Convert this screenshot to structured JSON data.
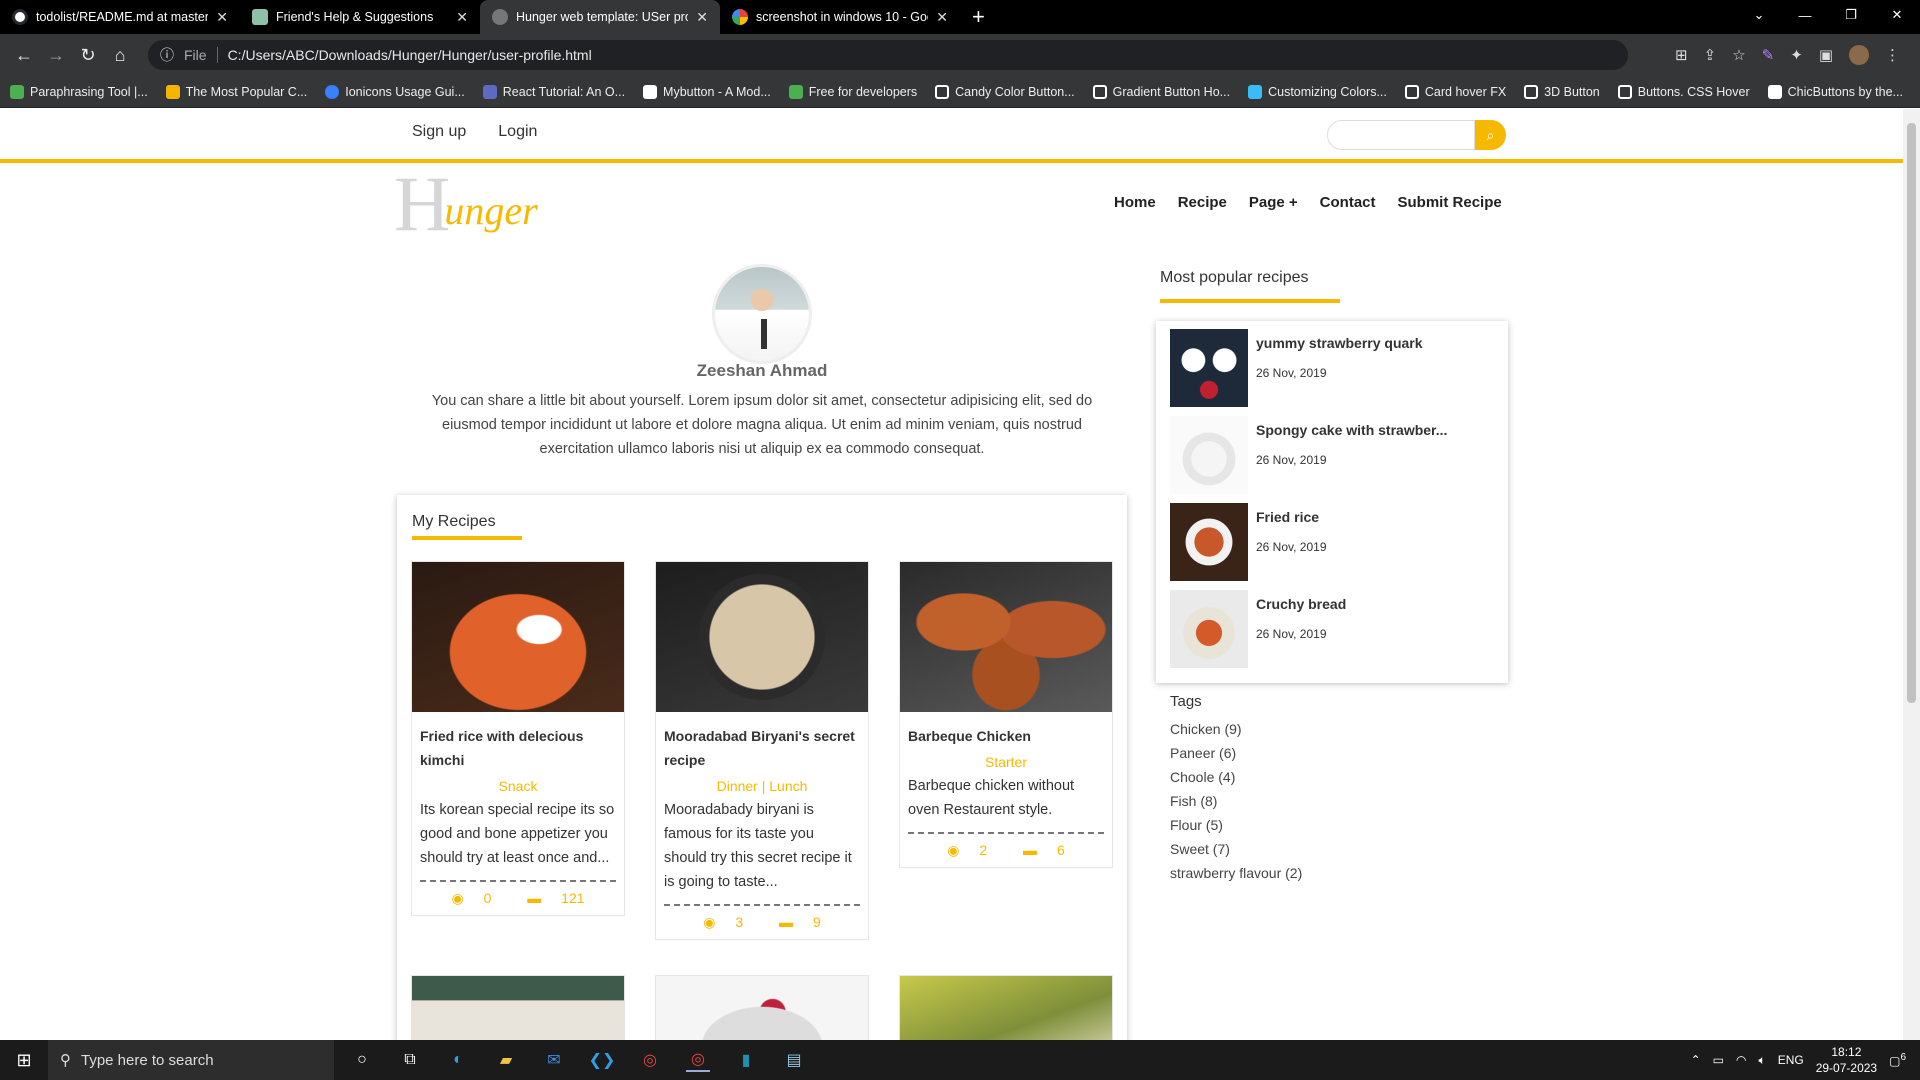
{
  "browser": {
    "tabs": [
      {
        "title": "todolist/README.md at master ·",
        "active": false,
        "color": "#24292f"
      },
      {
        "title": "Friend's Help & Suggestions",
        "active": false,
        "color": "#8fc1a9"
      },
      {
        "title": "Hunger web template: USer profi",
        "active": true,
        "color": "#777777"
      },
      {
        "title": "screenshot in windows 10 - Goog",
        "active": false,
        "color": "#4285f4"
      }
    ],
    "new_tab": "+",
    "address": {
      "scheme_label": "File",
      "url": "C:/Users/ABC/Downloads/Hunger/Hunger/user-profile.html"
    },
    "bookmarks": [
      {
        "label": "Paraphrasing Tool |...",
        "color": "#4caf50"
      },
      {
        "label": "The Most Popular C...",
        "color": "#f4b400"
      },
      {
        "label": "Ionicons Usage Gui...",
        "color": "#3880ff"
      },
      {
        "label": "React Tutorial: An O...",
        "color": "#5c6bc0"
      },
      {
        "label": "Mybutton - A Mod...",
        "color": "#ffffff"
      },
      {
        "label": "Free for developers",
        "color": "#4caf50"
      },
      {
        "label": "Candy Color Button...",
        "color": "#ffffff"
      },
      {
        "label": "Gradient Button Ho...",
        "color": "#ffffff"
      },
      {
        "label": "Customizing Colors...",
        "color": "#38bdf8"
      },
      {
        "label": "Card hover FX",
        "color": "#ffffff"
      },
      {
        "label": "3D Button",
        "color": "#ffffff"
      },
      {
        "label": "Buttons. CSS Hover",
        "color": "#ffffff"
      },
      {
        "label": "ChicButtons by the...",
        "color": "#ffffff"
      }
    ]
  },
  "site": {
    "top_links": [
      "Sign up",
      "Login"
    ],
    "logo_first": "H",
    "logo_rest": "unger",
    "nav": [
      "Home",
      "Recipe",
      "Page +",
      "Contact",
      "Submit Recipe"
    ],
    "accent": "#f7b900"
  },
  "profile": {
    "name": "Zeeshan Ahmad",
    "bio": "You can share a little bit about yourself. Lorem ipsum dolor sit amet, consectetur adipisicing elit, sed do eiusmod tempor incididunt ut labore et dolore magna aliqua. Ut enim ad minim veniam, quis nostrud exercitation ullamco laboris nisi ut aliquip ex ea commodo consequat."
  },
  "my_recipes": {
    "title": "My Recipes",
    "cards": [
      {
        "title": "Fried rice with delecious kimchi",
        "category": "Snack",
        "desc": "Its korean special recipe its so good and bone appetizer you should try at least once and...",
        "views": "0",
        "comments": "121"
      },
      {
        "title": "Mooradabad Biryani's secret recipe",
        "category": "Dinner | Lunch",
        "desc": "Mooradabady biryani is famous for its taste you should try this secret recipe it is going to taste...",
        "views": "3",
        "comments": "9"
      },
      {
        "title": "Barbeque Chicken",
        "category": "Starter",
        "desc": "Barbeque chicken without oven Restaurent style.",
        "views": "2",
        "comments": "6"
      }
    ]
  },
  "popular": {
    "title": "Most popular recipes",
    "items": [
      {
        "title": "yummy strawberry quark",
        "date": "26 Nov, 2019"
      },
      {
        "title": "Spongy cake with strawber...",
        "date": "26 Nov, 2019"
      },
      {
        "title": "Fried rice",
        "date": "26 Nov, 2019"
      },
      {
        "title": "Cruchy bread",
        "date": "26 Nov, 2019"
      }
    ]
  },
  "tags": {
    "title": "Tags",
    "items": [
      "Chicken (9)",
      "Paneer (6)",
      "Choole (4)",
      "Fish (8)",
      "Flour (5)",
      "Sweet (7)",
      "strawberry flavour (2)"
    ]
  },
  "taskbar": {
    "search_placeholder": "Type here to search",
    "lang": "ENG",
    "time": "18:12",
    "date": "29-07-2023",
    "notifications": "6"
  }
}
